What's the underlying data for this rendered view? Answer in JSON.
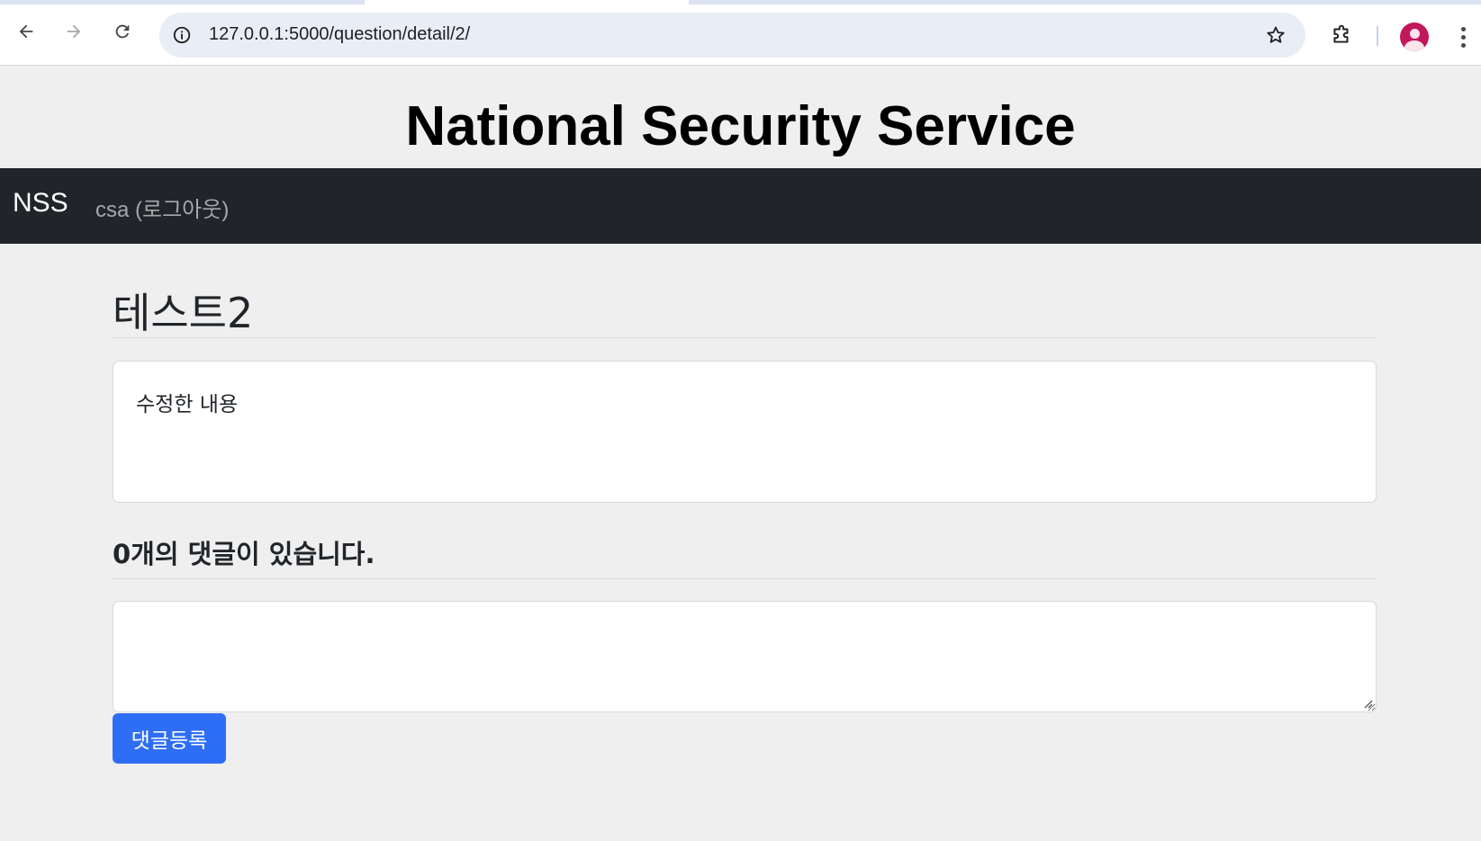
{
  "browser": {
    "url": "127.0.0.1:5000/question/detail/2/",
    "icons": {
      "back": "arrow-left-icon",
      "forward": "arrow-right-icon",
      "reload": "reload-icon",
      "site_info": "info-icon",
      "bookmark": "star-icon",
      "extensions": "puzzle-icon",
      "profile": "profile-avatar",
      "menu": "kebab-menu-icon"
    }
  },
  "site": {
    "title": "National Security Service"
  },
  "navbar": {
    "brand": "NSS",
    "user_link": "csa (로그아웃)"
  },
  "question": {
    "subject": "테스트2",
    "content": "수정한 내용"
  },
  "answers": {
    "count_text": "0개의 댓글이 있습니다.",
    "input_value": "",
    "submit_label": "댓글등록"
  },
  "colors": {
    "navbar_bg": "#212529",
    "page_bg": "#efefef",
    "primary_button": "#2e6ef5"
  }
}
